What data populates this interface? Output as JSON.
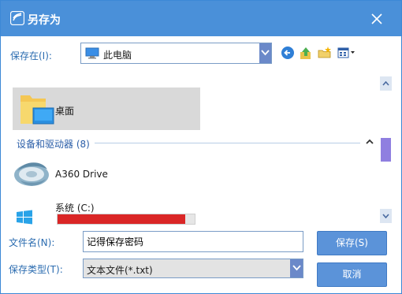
{
  "window": {
    "title": "另存为"
  },
  "toolbar": {
    "save_in_label": "保存在(I):",
    "location": "此电脑"
  },
  "file_list": {
    "folder": {
      "label": "桌面"
    },
    "group": {
      "label": "设备和驱动器 (8)"
    },
    "drive": {
      "label": "A360 Drive"
    },
    "system_drive": {
      "label": "系统 (C:)",
      "usage_fraction": 0.93
    }
  },
  "form": {
    "filename_label": "文件名(N):",
    "filename_value": "记得保存密码",
    "filetype_label": "保存类型(T):",
    "filetype_value": "文本文件(*.txt)"
  },
  "buttons": {
    "save": "保存(S)",
    "cancel": "取消"
  },
  "colors": {
    "title_bar": "#4a90d9",
    "accent_text": "#2b6cb0",
    "button": "#5b93d9",
    "usage_bar": "#da2626",
    "scroll_thumb": "#8f7fe0"
  },
  "icons": [
    "app-icon",
    "close-icon",
    "computer-icon",
    "back-icon",
    "up-folder-icon",
    "new-folder-icon",
    "view-menu-icon",
    "folder-icon",
    "a360-drive-icon",
    "windows-icon"
  ]
}
